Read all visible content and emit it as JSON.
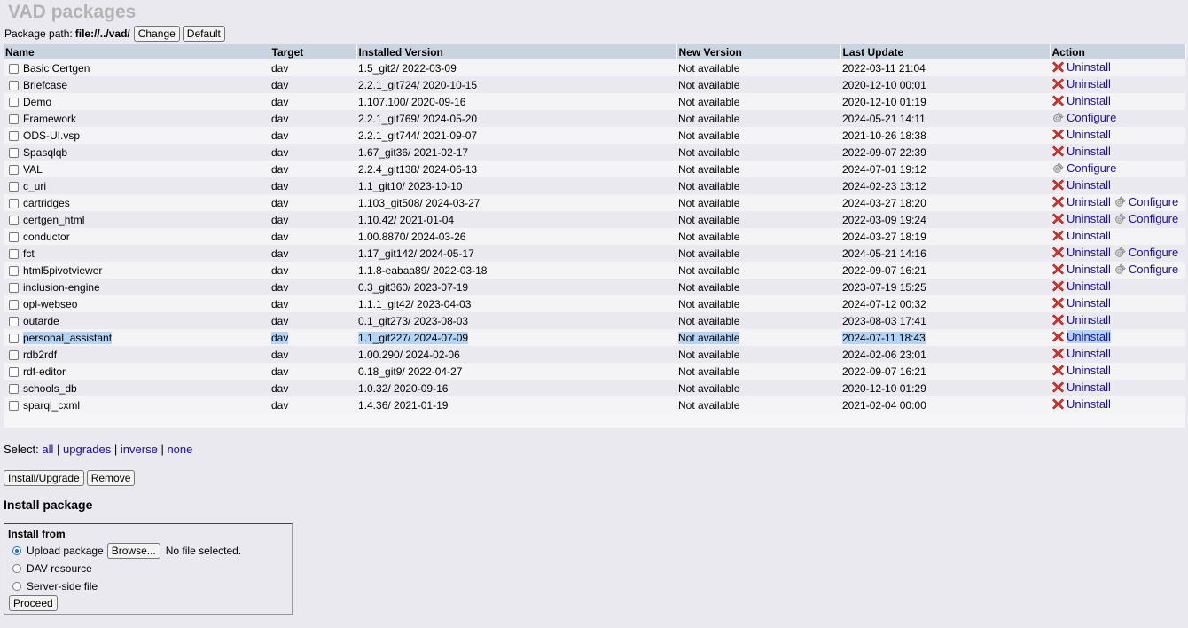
{
  "page": {
    "title": "VAD packages",
    "path_label": "Package path:",
    "path_value": "file://../vad/",
    "change_label": "Change",
    "default_label": "Default"
  },
  "table": {
    "headers": [
      "Name",
      "Target",
      "Installed Version",
      "New Version",
      "Last Update",
      "Action"
    ],
    "rows": [
      {
        "name": "Basic Certgen",
        "target": "dav",
        "installed": "1.5_git2/ 2022-03-09",
        "new": "Not available",
        "updated": "2022-03-11 21:04",
        "actions": [
          "Uninstall"
        ]
      },
      {
        "name": "Briefcase",
        "target": "dav",
        "installed": "2.2.1_git724/ 2020-10-15",
        "new": "Not available",
        "updated": "2020-12-10 00:01",
        "actions": [
          "Uninstall"
        ]
      },
      {
        "name": "Demo",
        "target": "dav",
        "installed": "1.107.100/ 2020-09-16",
        "new": "Not available",
        "updated": "2020-12-10 01:19",
        "actions": [
          "Uninstall"
        ]
      },
      {
        "name": "Framework",
        "target": "dav",
        "installed": "2.2.1_git769/ 2024-05-20",
        "new": "Not available",
        "updated": "2024-05-21 14:11",
        "actions": [
          "Configure"
        ]
      },
      {
        "name": "ODS-UI.vsp",
        "target": "dav",
        "installed": "2.2.1_git744/ 2021-09-07",
        "new": "Not available",
        "updated": "2021-10-26 18:38",
        "actions": [
          "Uninstall"
        ]
      },
      {
        "name": "Spasqlqb",
        "target": "dav",
        "installed": "1.67_git36/ 2021-02-17",
        "new": "Not available",
        "updated": "2022-09-07 22:39",
        "actions": [
          "Uninstall"
        ]
      },
      {
        "name": "VAL",
        "target": "dav",
        "installed": "2.2.4_git138/ 2024-06-13",
        "new": "Not available",
        "updated": "2024-07-01 19:12",
        "actions": [
          "Configure"
        ]
      },
      {
        "name": "c_uri",
        "target": "dav",
        "installed": "1.1_git10/ 2023-10-10",
        "new": "Not available",
        "updated": "2024-02-23 13:12",
        "actions": [
          "Uninstall"
        ]
      },
      {
        "name": "cartridges",
        "target": "dav",
        "installed": "1.103_git508/ 2024-03-27",
        "new": "Not available",
        "updated": "2024-03-27 18:20",
        "actions": [
          "Uninstall",
          "Configure"
        ]
      },
      {
        "name": "certgen_html",
        "target": "dav",
        "installed": "1.10.42/ 2021-01-04",
        "new": "Not available",
        "updated": "2022-03-09 19:24",
        "actions": [
          "Uninstall",
          "Configure"
        ]
      },
      {
        "name": "conductor",
        "target": "dav",
        "installed": "1.00.8870/ 2024-03-26",
        "new": "Not available",
        "updated": "2024-03-27 18:19",
        "actions": [
          "Uninstall"
        ]
      },
      {
        "name": "fct",
        "target": "dav",
        "installed": "1.17_git142/ 2024-05-17",
        "new": "Not available",
        "updated": "2024-05-21 14:16",
        "actions": [
          "Uninstall",
          "Configure"
        ]
      },
      {
        "name": "html5pivotviewer",
        "target": "dav",
        "installed": "1.1.8-eabaa89/ 2022-03-18",
        "new": "Not available",
        "updated": "2022-09-07 16:21",
        "actions": [
          "Uninstall",
          "Configure"
        ]
      },
      {
        "name": "inclusion-engine",
        "target": "dav",
        "installed": "0.3_git360/ 2023-07-19",
        "new": "Not available",
        "updated": "2023-07-19 15:25",
        "actions": [
          "Uninstall"
        ]
      },
      {
        "name": "opl-webseo",
        "target": "dav",
        "installed": "1.1.1_git42/ 2023-04-03",
        "new": "Not available",
        "updated": "2024-07-12 00:32",
        "actions": [
          "Uninstall"
        ]
      },
      {
        "name": "outarde",
        "target": "dav",
        "installed": "0.1_git273/ 2023-08-03",
        "new": "Not available",
        "updated": "2023-08-03 17:41",
        "actions": [
          "Uninstall"
        ]
      },
      {
        "name": "personal_assistant",
        "target": "dav",
        "installed": "1.1_git227/ 2024-07-09",
        "new": "Not available",
        "updated": "2024-07-11 18:43",
        "actions": [
          "Uninstall"
        ],
        "selected": true
      },
      {
        "name": "rdb2rdf",
        "target": "dav",
        "installed": "1.00.290/ 2024-02-06",
        "new": "Not available",
        "updated": "2024-02-06 23:01",
        "actions": [
          "Uninstall"
        ]
      },
      {
        "name": "rdf-editor",
        "target": "dav",
        "installed": "0.18_git9/ 2022-04-27",
        "new": "Not available",
        "updated": "2022-09-07 16:21",
        "actions": [
          "Uninstall"
        ]
      },
      {
        "name": "schools_db",
        "target": "dav",
        "installed": "1.0.32/ 2020-09-16",
        "new": "Not available",
        "updated": "2020-12-10 01:29",
        "actions": [
          "Uninstall"
        ]
      },
      {
        "name": "sparql_cxml",
        "target": "dav",
        "installed": "1.4.36/ 2021-01-19",
        "new": "Not available",
        "updated": "2021-02-04 00:00",
        "actions": [
          "Uninstall"
        ]
      }
    ]
  },
  "select": {
    "label": "Select:",
    "all": "all",
    "upgrades": "upgrades",
    "inverse": "inverse",
    "none": "none",
    "sep": "|"
  },
  "buttons": {
    "install_upgrade": "Install/Upgrade",
    "remove": "Remove"
  },
  "install": {
    "heading": "Install package",
    "from_label": "Install from",
    "upload_label": "Upload package",
    "browse_label": "Browse...",
    "no_file": "No file selected.",
    "dav_label": "DAV resource",
    "server_label": "Server-side file",
    "proceed_label": "Proceed"
  },
  "colors": {
    "header_bg": "#c9d4e0",
    "link": "#1a0dab",
    "uninstall_icon": "#d9342b",
    "selection": "#b3d4f5"
  },
  "icons": {
    "uninstall": "red-x-icon",
    "configure": "gear-icon"
  }
}
